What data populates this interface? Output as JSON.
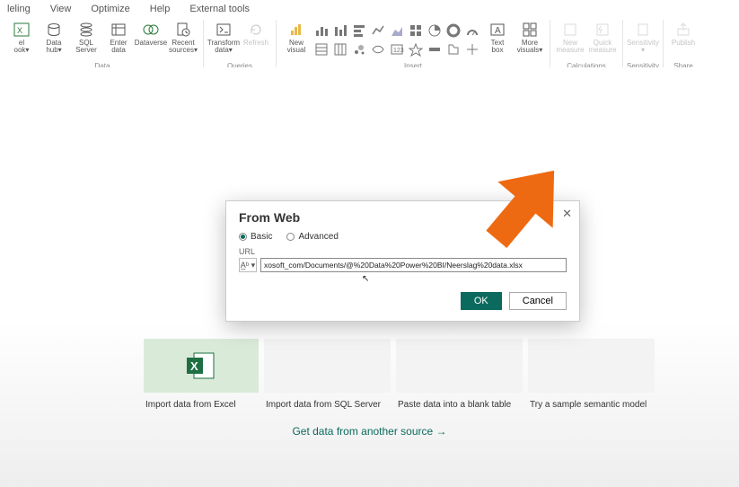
{
  "tabs": [
    "leling",
    "View",
    "Optimize",
    "Help",
    "External tools"
  ],
  "ribbon": {
    "data": {
      "label": "Data",
      "items": [
        {
          "name": "excel-workbook",
          "l1": "el",
          "l2": "ook▾"
        },
        {
          "name": "data-hub",
          "l1": "Data",
          "l2": "hub▾"
        },
        {
          "name": "sql-server",
          "l1": "SQL",
          "l2": "Server"
        },
        {
          "name": "enter-data",
          "l1": "Enter",
          "l2": "data"
        },
        {
          "name": "dataverse",
          "l1": "Dataverse",
          "l2": ""
        },
        {
          "name": "recent-sources",
          "l1": "Recent",
          "l2": "sources▾"
        }
      ]
    },
    "queries": {
      "label": "Queries",
      "items": [
        {
          "name": "transform-data",
          "l1": "Transform",
          "l2": "data▾"
        },
        {
          "name": "refresh",
          "l1": "Refresh",
          "l2": ""
        }
      ]
    },
    "insert": {
      "label": "Insert",
      "left": [
        {
          "name": "new-visual",
          "l1": "New",
          "l2": "visual"
        }
      ],
      "right": [
        {
          "name": "text-box",
          "l1": "Text",
          "l2": "box"
        },
        {
          "name": "more-visuals",
          "l1": "More",
          "l2": "visuals▾"
        }
      ]
    },
    "calc": {
      "label": "Calculations",
      "items": [
        {
          "name": "new-measure",
          "l1": "New",
          "l2": "measure"
        },
        {
          "name": "quick-measure",
          "l1": "Quick",
          "l2": "measure"
        }
      ]
    },
    "sens": {
      "label": "Sensitivity",
      "items": [
        {
          "name": "sensitivity",
          "l1": "Sensitivity",
          "l2": "▾"
        }
      ]
    },
    "share": {
      "label": "Share",
      "items": [
        {
          "name": "publish",
          "l1": "Publish",
          "l2": ""
        }
      ]
    }
  },
  "tiles": {
    "labels": [
      "Import data from Excel",
      "Import data from SQL Server",
      "Paste data into a blank table",
      "Try a sample semantic model"
    ],
    "more": "Get data from another source →"
  },
  "dialog": {
    "title": "From Web",
    "basic": "Basic",
    "advanced": "Advanced",
    "url_label": "URL",
    "prefix": "A̲ᵇ ▾",
    "url_value": "xosoft_com/Documents/@%20Data%20Power%20BI/Neerslag%20data.xlsx",
    "ok": "OK",
    "cancel": "Cancel"
  }
}
